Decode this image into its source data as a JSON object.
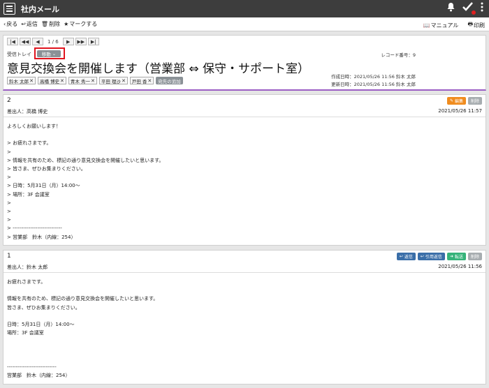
{
  "app": {
    "title": "社内メール"
  },
  "actionbar": {
    "back": "戻る",
    "reply": "返信",
    "delete": "削除",
    "mark": "マークする",
    "manual": "マニュアル",
    "print": "印刷"
  },
  "pager": {
    "text": "1 / 6"
  },
  "header": {
    "folder": "受信トレイ",
    "move_label": "移動",
    "subject": "意見交換会を開催します（営業部 ⇔ 保守・サポート室）",
    "record_no": "レコード番号：9",
    "created": "作成日時：2021/05/26 11:56 鈴木 太郎",
    "updated": "更新日時：2021/05/26 11:56 鈴木 太郎",
    "recipients": [
      "鈴木 太郎",
      "高橋 博史",
      "青木 秀一",
      "平田 理沙",
      "戸田 香"
    ],
    "add_recipient": "宛先の追加"
  },
  "messages": [
    {
      "number": "2",
      "sender": "差出人：高橋 博史",
      "date": "2021/05/26 11:57",
      "actions": {
        "edit": "編集",
        "delete": "削除"
      },
      "body": "よろしくお願いします！\n\n> お疲れさまです。\n>\n> 情報を共有のため、標記の通り意見交換会を開催したいと思います。\n> 皆さま、ぜひお集まりください。\n>\n> 日時：5月31日（月）14:00〜\n> 場所：3F 会議室\n>\n>\n>\n> ----------------------------\n> 営業部　鈴木（内線：254）"
    },
    {
      "number": "1",
      "sender": "差出人：鈴木 太郎",
      "date": "2021/05/26 11:56",
      "actions": {
        "reply": "返信",
        "quote_reply": "引用返信",
        "forward": "転送",
        "delete": "削除"
      },
      "body": "お疲れさまです。\n\n情報を共有のため、標記の通り意見交換会を開催したいと思います。\n皆さま、ぜひお集まりください。\n\n日時：5月31日（月）14:00〜\n場所：3F 会議室\n\n\n\n----------------------------\n営業部　鈴木（内線：254）"
    }
  ]
}
